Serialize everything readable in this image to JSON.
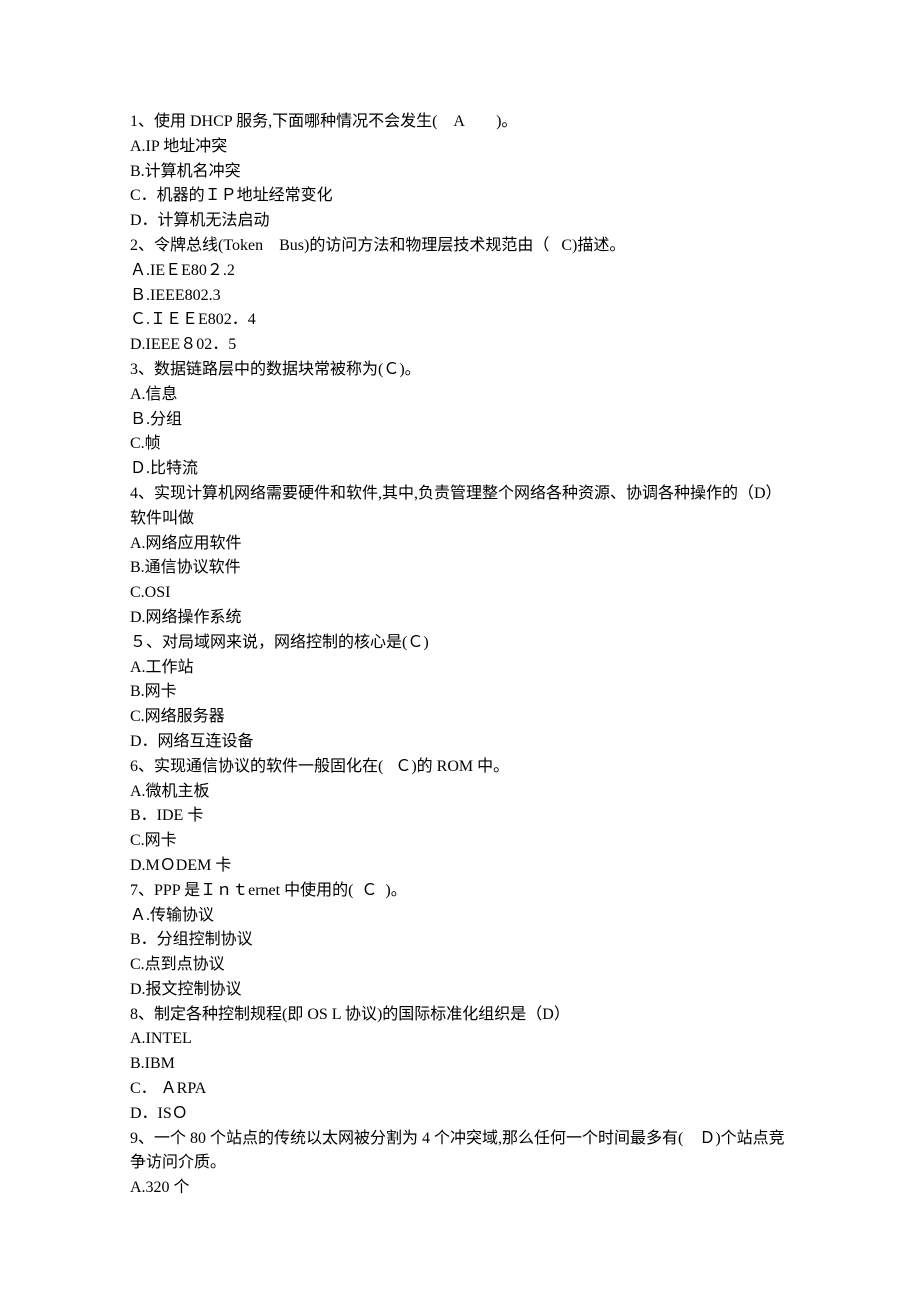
{
  "lines": [
    "1、使用 DHCP 服务,下面哪种情况不会发生(    A        )。",
    "A.IP 地址冲突",
    "B.计算机名冲突",
    "C．机器的ＩＰ地址经常变化",
    "D．计算机无法启动",
    "2、令牌总线(Token    Bus)的访问方法和物理层技术规范由（   C)描述。",
    "Ａ.IEＥE80２.2",
    "Ｂ.IEEE802.3",
    "Ｃ.ＩＥＥE802．4",
    "D.IEEE８02．5",
    "3、数据链路层中的数据块常被称为(Ｃ)。",
    "A.信息",
    "Ｂ.分组",
    "C.帧",
    "Ｄ.比特流",
    "4、实现计算机网络需要硬件和软件,其中,负责管理整个网络各种资源、协调各种操作的（D）软件叫做",
    "A.网络应用软件",
    "B.通信协议软件",
    "C.OSI",
    "D.网络操作系统",
    "５、对局域网来说，网络控制的核心是(Ｃ)",
    "A.工作站",
    "B.网卡",
    "C.网络服务器",
    "D．网络互连设备",
    "6、实现通信协议的软件一般固化在(   Ｃ)的 ROM 中。",
    "A.微机主板",
    "B．IDE 卡",
    "C.网卡",
    "D.MＯDEM 卡",
    "7、PPP 是Ｉｎｔernet 中使用的(  Ｃ  )。",
    "Ａ.传输协议",
    "B．分组控制协议",
    "C.点到点协议",
    "D.报文控制协议",
    "8、制定各种控制规程(即 OS L 协议)的国际标准化组织是（D）",
    "A.INTEL",
    "B.IBM",
    "C． ＡRPA",
    "D．ISＯ",
    "9、一个 80 个站点的传统以太网被分割为 4 个冲突域,那么任何一个时间最多有(    Ｄ)个站点竞争访问介质。",
    "A.320 个"
  ]
}
